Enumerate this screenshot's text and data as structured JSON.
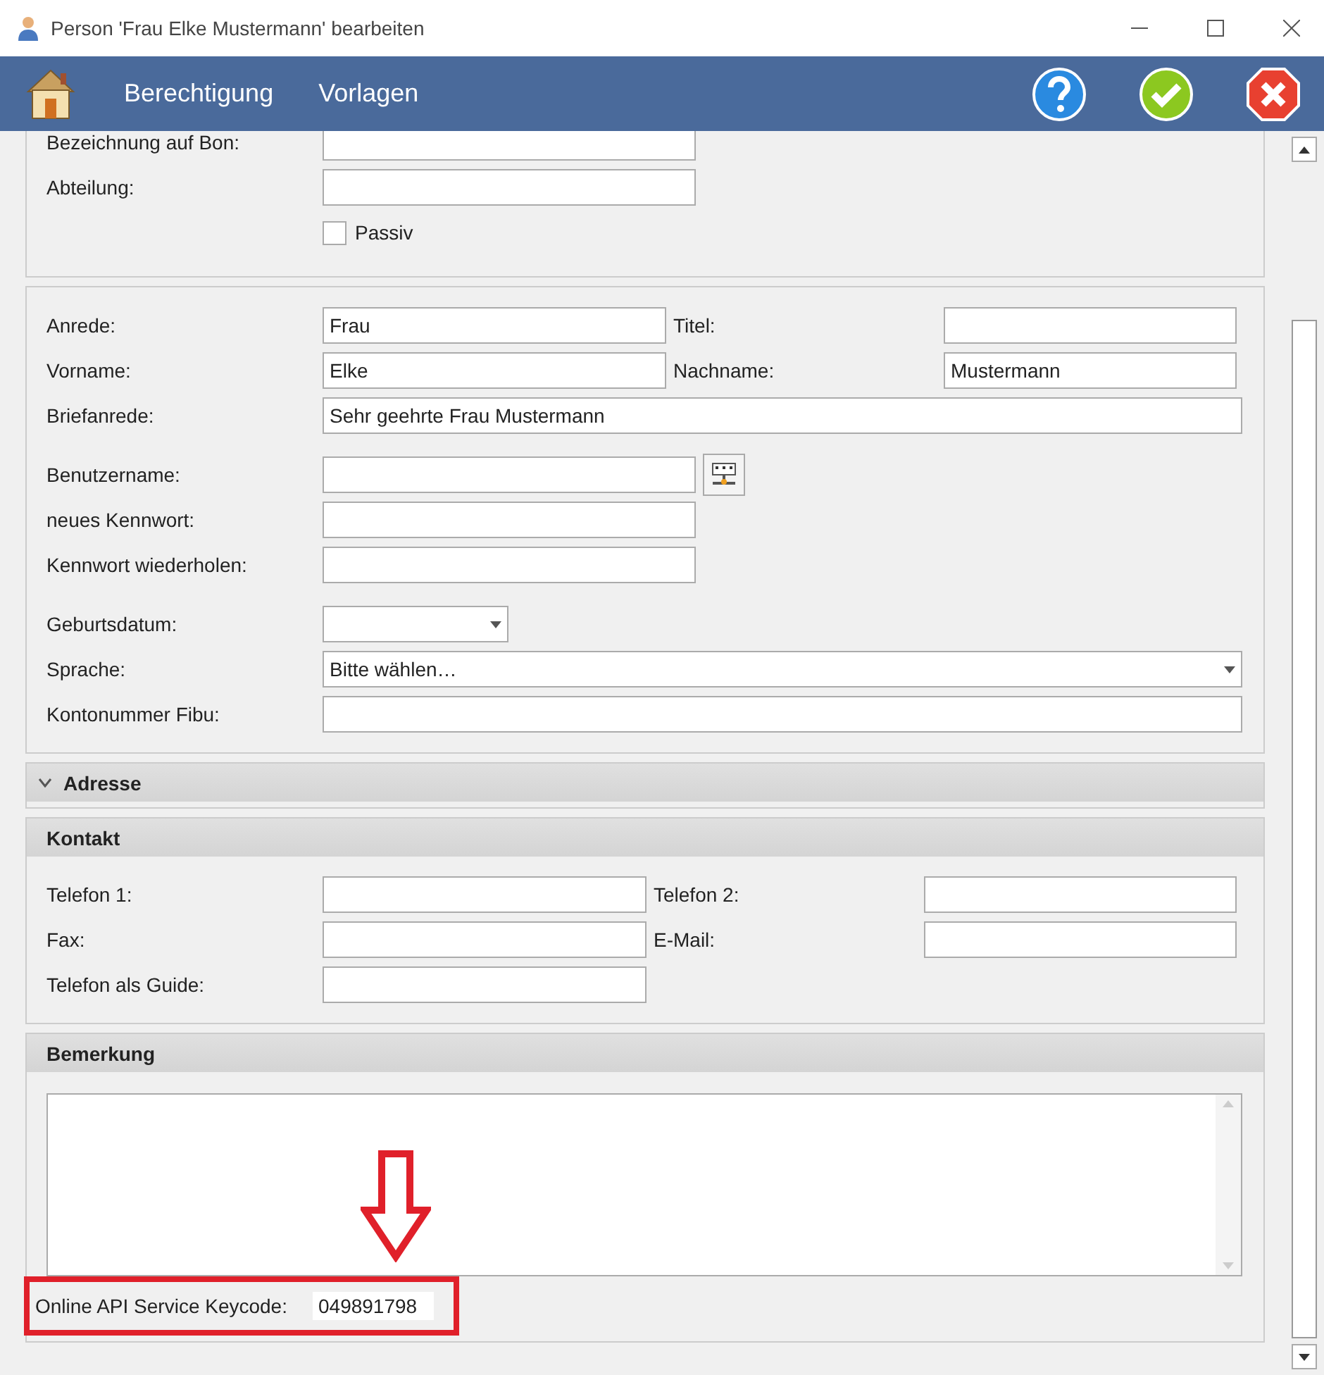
{
  "window": {
    "title": "Person 'Frau Elke Mustermann' bearbeiten"
  },
  "toolbar": {
    "menu": [
      {
        "label": "Berechtigung"
      },
      {
        "label": "Vorlagen"
      }
    ]
  },
  "sections": [
    {
      "kind": "form",
      "groups": [
        [
          {
            "kind": "single",
            "label": "Bezeichnung auf Bon:"
          },
          {
            "kind": "single",
            "label": "Abteilung:"
          },
          {
            "kind": "checkbox",
            "label": "Passiv",
            "checked": false
          }
        ]
      ]
    },
    {
      "kind": "form",
      "groups": [
        [
          {
            "kind": "pair",
            "label": "Anrede:",
            "value": "Frau",
            "label2": "Titel:"
          },
          {
            "kind": "pair",
            "label": "Vorname:",
            "value": "Elke",
            "label2": "Nachname:",
            "value2": "Mustermann"
          },
          {
            "kind": "wide",
            "label": "Briefanrede:",
            "value": "Sehr geehrte Frau Mustermann"
          }
        ],
        [
          {
            "kind": "single_button",
            "label": "Benutzername:"
          },
          {
            "kind": "single",
            "label": "neues Kennwort:"
          },
          {
            "kind": "single",
            "label": "Kennwort wiederholen:"
          }
        ],
        [
          {
            "kind": "date",
            "label": "Geburtsdatum:"
          },
          {
            "kind": "select",
            "label": "Sprache:",
            "value": "Bitte wählen…"
          },
          {
            "kind": "wide",
            "label": "Kontonummer Fibu:"
          }
        ]
      ]
    },
    {
      "kind": "collapsible",
      "title": "Adresse",
      "expanded": false
    },
    {
      "kind": "form",
      "title": "Kontakt",
      "groups": [
        [
          {
            "kind": "pair_narrow",
            "label": "Telefon 1:",
            "label2": "Telefon 2:"
          },
          {
            "kind": "pair_narrow",
            "label": "Fax:",
            "label2": "E-Mail:"
          },
          {
            "kind": "single_narrow",
            "label": "Telefon als Guide:"
          }
        ]
      ]
    },
    {
      "kind": "notes",
      "title": "Bemerkung",
      "keycode_label": "Online API Service Keycode:",
      "keycode_value": "049891798",
      "highlighted": true
    }
  ]
}
